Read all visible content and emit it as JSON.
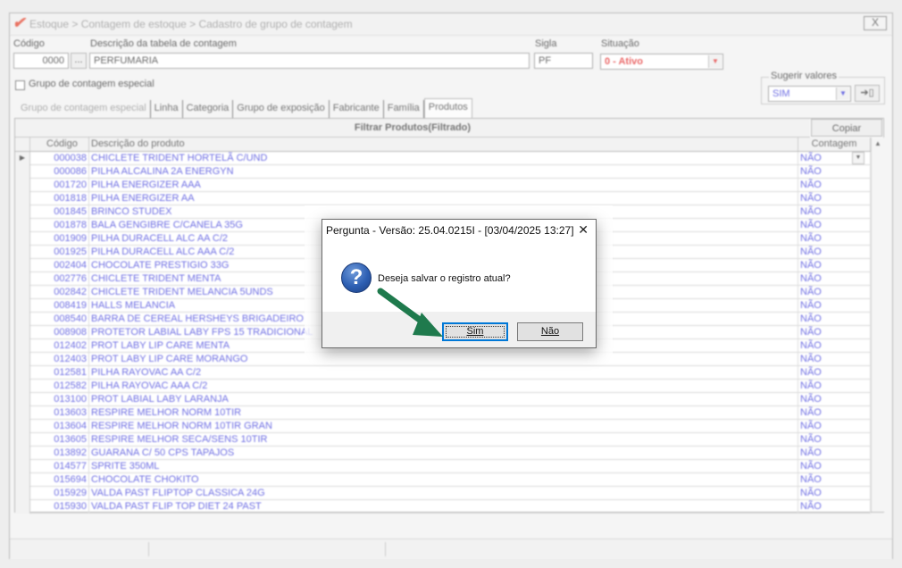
{
  "window": {
    "title": "Estoque > Contagem de estoque > Cadastro de grupo de contagem",
    "close": "X"
  },
  "form": {
    "codigo_label": "Código",
    "codigo_value": "0000",
    "lookup_button": "...",
    "descricao_label": "Descrição da tabela de contagem",
    "descricao_value": "PERFUMARIA",
    "sigla_label": "Sigla",
    "sigla_value": "PF",
    "situacao_label": "Situação",
    "situacao_value": "0 - Ativo",
    "situacao_color": "#e02020",
    "especial_label": "Grupo de contagem especial",
    "sugerir_label": "Sugerir valores",
    "sugerir_value": "SIM",
    "apply_icon": "arrow-into-box-icon"
  },
  "tabs": [
    {
      "label": "Grupo de contagem especial"
    },
    {
      "label": "Linha"
    },
    {
      "label": "Categoria"
    },
    {
      "label": "Grupo de exposição"
    },
    {
      "label": "Fabricante"
    },
    {
      "label": "Família"
    },
    {
      "label": "Produtos"
    }
  ],
  "grid": {
    "filter_title": "Filtrar Produtos(Filtrado)",
    "copy_label": "Copiar",
    "columns": {
      "codigo": "Código",
      "descricao": "Descrição do produto",
      "contagem": "Contagem"
    },
    "rows": [
      {
        "code": "000038",
        "desc": "CHICLETE TRIDENT HORTELÃ C/UND",
        "cont": "NÃO"
      },
      {
        "code": "000086",
        "desc": "PILHA ALCALINA 2A ENERGYN",
        "cont": "NÃO"
      },
      {
        "code": "001720",
        "desc": "PILHA ENERGIZER AAA",
        "cont": "NÃO"
      },
      {
        "code": "001818",
        "desc": "PILHA ENERGIZER AA",
        "cont": "NÃO"
      },
      {
        "code": "001845",
        "desc": "BRINCO STUDEX",
        "cont": "NÃO"
      },
      {
        "code": "001878",
        "desc": "BALA GENGIBRE C/CANELA 35G",
        "cont": "NÃO"
      },
      {
        "code": "001909",
        "desc": "PILHA DURACELL ALC AA C/2",
        "cont": "NÃO"
      },
      {
        "code": "001925",
        "desc": "PILHA DURACELL ALC AAA C/2",
        "cont": "NÃO"
      },
      {
        "code": "002404",
        "desc": "CHOCOLATE PRESTIGIO 33G",
        "cont": "NÃO"
      },
      {
        "code": "002776",
        "desc": "CHICLETE TRIDENT MENTA",
        "cont": "NÃO"
      },
      {
        "code": "002842",
        "desc": "CHICLETE TRIDENT MELANCIA 5UNDS",
        "cont": "NÃO"
      },
      {
        "code": "008419",
        "desc": "HALLS MELANCIA",
        "cont": "NÃO"
      },
      {
        "code": "008540",
        "desc": "BARRA DE CEREAL HERSHEYS BRIGADEIRO",
        "cont": "NÃO"
      },
      {
        "code": "008908",
        "desc": "PROTETOR LABIAL LABY FPS 15 TRADICIONAL",
        "cont": "NÃO"
      },
      {
        "code": "012402",
        "desc": "PROT LABY LIP CARE MENTA",
        "cont": "NÃO"
      },
      {
        "code": "012403",
        "desc": "PROT LABY LIP CARE MORANGO",
        "cont": "NÃO"
      },
      {
        "code": "012581",
        "desc": "PILHA RAYOVAC AA C/2",
        "cont": "NÃO"
      },
      {
        "code": "012582",
        "desc": "PILHA RAYOVAC AAA C/2",
        "cont": "NÃO"
      },
      {
        "code": "013100",
        "desc": "PROT LABIAL LABY LARANJA",
        "cont": "NÃO"
      },
      {
        "code": "013603",
        "desc": "RESPIRE MELHOR NORM 10TIR",
        "cont": "NÃO"
      },
      {
        "code": "013604",
        "desc": "RESPIRE MELHOR NORM 10TIR GRAN",
        "cont": "NÃO"
      },
      {
        "code": "013605",
        "desc": "RESPIRE MELHOR SECA/SENS 10TIR",
        "cont": "NÃO"
      },
      {
        "code": "013892",
        "desc": "GUARANA C/ 50 CPS TAPAJOS",
        "cont": "NÃO"
      },
      {
        "code": "014577",
        "desc": "SPRITE 350ML",
        "cont": "NÃO"
      },
      {
        "code": "015694",
        "desc": "CHOCOLATE CHOKITO",
        "cont": "NÃO"
      },
      {
        "code": "015929",
        "desc": "VALDA PAST FLIPTOP CLASSICA 24G",
        "cont": "NÃO"
      },
      {
        "code": "015930",
        "desc": "VALDA PAST FLIP TOP DIET 24 PAST",
        "cont": "NÃO"
      }
    ]
  },
  "dialog": {
    "title": "Pergunta - Versão: 25.04.0215I - [03/04/2025 13:27]",
    "close": "✕",
    "icon": "question-icon",
    "message": "Deseja salvar o registro atual?",
    "yes_label": "Sim",
    "no_label": "Não"
  },
  "annotation": {
    "arrow_color": "#1f7a4d"
  }
}
